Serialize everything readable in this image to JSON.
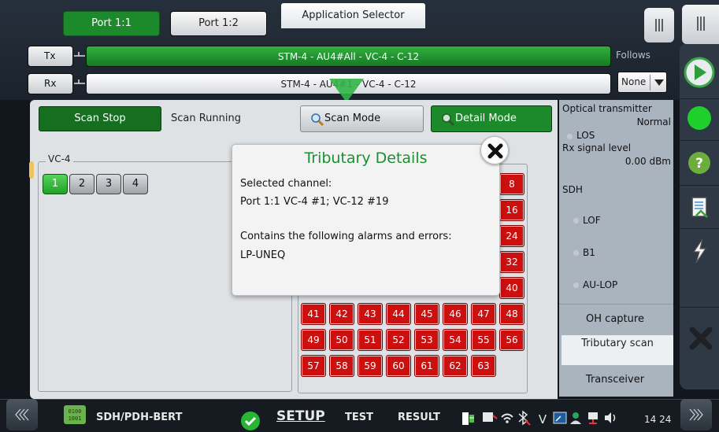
{
  "top": {
    "ports": [
      "Port 1:1",
      "Port 1:2"
    ],
    "app_selector": "Application Selector",
    "tx_label": "Tx",
    "rx_label": "Rx",
    "tx_path": "STM-4 - AU4#All - VC-4 - C-12",
    "rx_path": "STM-4 - AU4#1 - VC-4 - C-12",
    "follows_label": "Follows",
    "follows_value": "None"
  },
  "scan": {
    "stop_button": "Scan Stop",
    "status": "Scan Running",
    "scan_mode": "Scan Mode",
    "detail_mode": "Detail Mode",
    "vc4_label": "VC-4",
    "vc4_channels": [
      "1",
      "2",
      "3",
      "4"
    ],
    "selected_channel": "1",
    "tributaries": [
      "8",
      "16",
      "24",
      "32",
      "40",
      "41",
      "42",
      "43",
      "44",
      "45",
      "46",
      "47",
      "48",
      "49",
      "50",
      "51",
      "52",
      "53",
      "54",
      "55",
      "56",
      "57",
      "58",
      "59",
      "60",
      "61",
      "62",
      "63"
    ]
  },
  "dialog": {
    "title": "Tributary Details",
    "line1": "Selected channel:",
    "line2": "Port 1:1 VC-4 #1; VC-12 #19",
    "line3": "Contains the following alarms and errors:",
    "line4": "LP-UNEQ"
  },
  "status_panel": {
    "optical_title": "Optical transmitter",
    "optical_value": "Normal",
    "los": "LOS",
    "rx_level_label": "Rx signal level",
    "rx_level_value": "0.00 dBm",
    "sdh": "SDH",
    "lof": "LOF",
    "b1": "B1",
    "au_lop": "AU-LOP",
    "tabs": [
      "OH capture",
      "Tributary scan",
      "Transceiver"
    ]
  },
  "bottom": {
    "app_name": "SDH/PDH-BERT",
    "setup": "SETUP",
    "test": "TEST",
    "result": "RESULT",
    "time": "14 24"
  },
  "colors": {
    "accent_green": "#1c8a2a",
    "error_red": "#cc0f0f",
    "title_green": "#1a9030"
  }
}
